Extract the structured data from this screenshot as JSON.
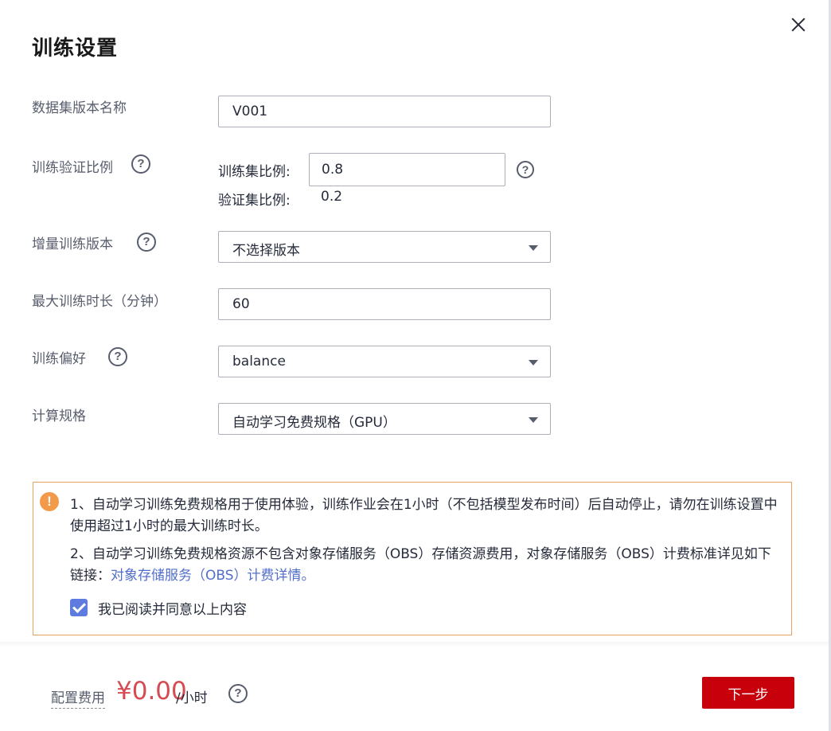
{
  "dialog": {
    "title": "训练设置",
    "close_icon": "close-icon"
  },
  "form": {
    "dataset_version": {
      "label": "数据集版本名称",
      "value": "V001"
    },
    "split_ratio": {
      "label": "训练验证比例",
      "train_label": "训练集比例:",
      "train_value": "0.8",
      "val_label": "验证集比例:",
      "val_value": "0.2"
    },
    "incremental_version": {
      "label": "增量训练版本",
      "value": "不选择版本"
    },
    "max_duration": {
      "label": "最大训练时长（分钟）",
      "value": "60"
    },
    "preference": {
      "label": "训练偏好",
      "value": "balance"
    },
    "compute_spec": {
      "label": "计算规格",
      "value": "自动学习免费规格（GPU）"
    },
    "help_glyph": "?"
  },
  "notice": {
    "icon_glyph": "!",
    "line1": "1、自动学习训练免费规格用于使用体验，训练作业会在1小时（不包括模型发布时间）后自动停止，请勿在训练设置中使用超过1小时的最大训练时长。",
    "line2_prefix": "2、自动学习训练免费规格资源不包含对象存储服务（OBS）存储资源费用，对象存储服务（OBS）计费标准详见如下链接：",
    "line2_link": "对象存储服务（OBS）计费详情。",
    "agree_label": "我已阅读并同意以上内容",
    "agree_checked": true
  },
  "footer": {
    "cost_label": "配置费用",
    "price": "¥0.00",
    "unit": "/小时",
    "next_label": "下一步"
  },
  "colors": {
    "primary_button": "#c7000b",
    "price": "#d64a52",
    "warning": "#f2994a",
    "link": "#526ecc",
    "checkbox": "#5e7ce0"
  }
}
